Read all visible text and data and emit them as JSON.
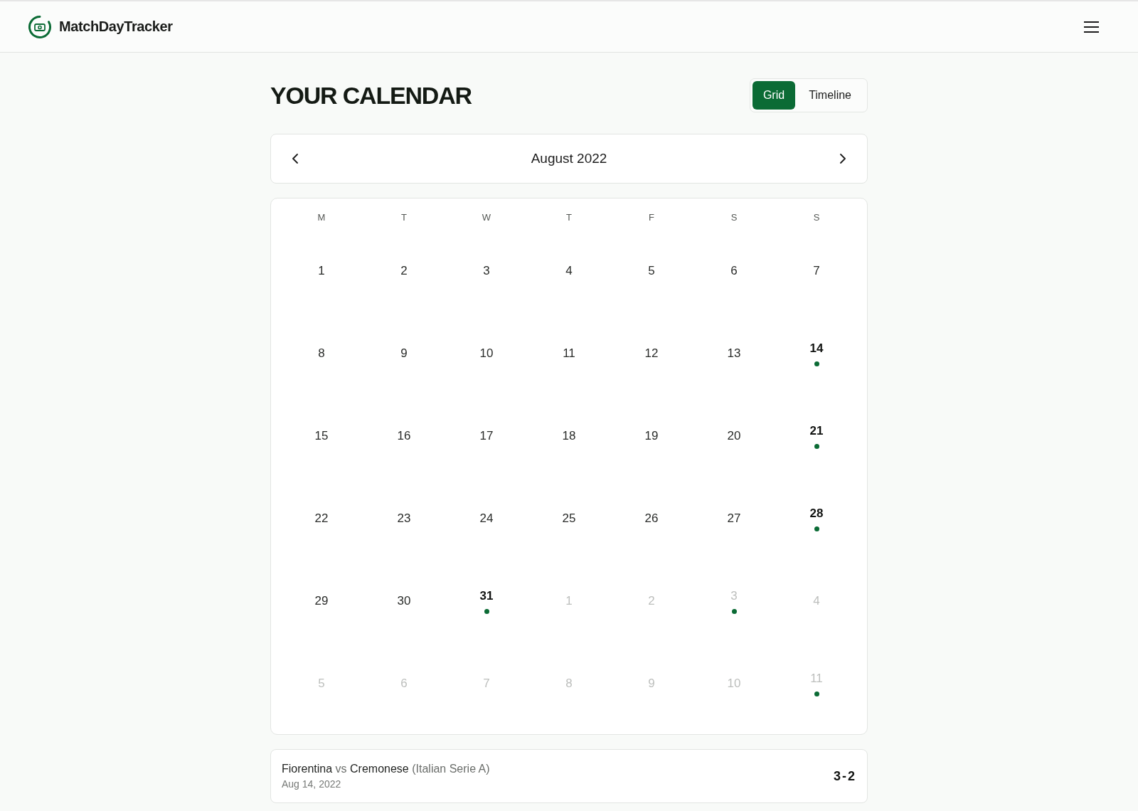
{
  "header": {
    "brand": "MatchDayTracker"
  },
  "title": "YOUR CALENDAR",
  "view_toggle": [
    {
      "label": "Grid",
      "selected": true
    },
    {
      "label": "Timeline",
      "selected": false
    }
  ],
  "month_nav": {
    "month": "August 2022"
  },
  "calendar": {
    "weekdays": [
      "M",
      "T",
      "W",
      "T",
      "F",
      "S",
      "S"
    ],
    "days": [
      {
        "label": "1",
        "in_month": true,
        "match": false
      },
      {
        "label": "2",
        "in_month": true,
        "match": false
      },
      {
        "label": "3",
        "in_month": true,
        "match": false
      },
      {
        "label": "4",
        "in_month": true,
        "match": false
      },
      {
        "label": "5",
        "in_month": true,
        "match": false
      },
      {
        "label": "6",
        "in_month": true,
        "match": false
      },
      {
        "label": "7",
        "in_month": true,
        "match": false
      },
      {
        "label": "8",
        "in_month": true,
        "match": false
      },
      {
        "label": "9",
        "in_month": true,
        "match": false
      },
      {
        "label": "10",
        "in_month": true,
        "match": false
      },
      {
        "label": "11",
        "in_month": true,
        "match": false
      },
      {
        "label": "12",
        "in_month": true,
        "match": false
      },
      {
        "label": "13",
        "in_month": true,
        "match": false
      },
      {
        "label": "14",
        "in_month": true,
        "match": true
      },
      {
        "label": "15",
        "in_month": true,
        "match": false
      },
      {
        "label": "16",
        "in_month": true,
        "match": false
      },
      {
        "label": "17",
        "in_month": true,
        "match": false
      },
      {
        "label": "18",
        "in_month": true,
        "match": false
      },
      {
        "label": "19",
        "in_month": true,
        "match": false
      },
      {
        "label": "20",
        "in_month": true,
        "match": false
      },
      {
        "label": "21",
        "in_month": true,
        "match": true
      },
      {
        "label": "22",
        "in_month": true,
        "match": false
      },
      {
        "label": "23",
        "in_month": true,
        "match": false
      },
      {
        "label": "24",
        "in_month": true,
        "match": false
      },
      {
        "label": "25",
        "in_month": true,
        "match": false
      },
      {
        "label": "26",
        "in_month": true,
        "match": false
      },
      {
        "label": "27",
        "in_month": true,
        "match": false
      },
      {
        "label": "28",
        "in_month": true,
        "match": true
      },
      {
        "label": "29",
        "in_month": true,
        "match": false
      },
      {
        "label": "30",
        "in_month": true,
        "match": false
      },
      {
        "label": "31",
        "in_month": true,
        "match": true
      },
      {
        "label": "1",
        "in_month": false,
        "match": false
      },
      {
        "label": "2",
        "in_month": false,
        "match": false
      },
      {
        "label": "3",
        "in_month": false,
        "match": true
      },
      {
        "label": "4",
        "in_month": false,
        "match": false
      },
      {
        "label": "5",
        "in_month": false,
        "match": false
      },
      {
        "label": "6",
        "in_month": false,
        "match": false
      },
      {
        "label": "7",
        "in_month": false,
        "match": false
      },
      {
        "label": "8",
        "in_month": false,
        "match": false
      },
      {
        "label": "9",
        "in_month": false,
        "match": false
      },
      {
        "label": "10",
        "in_month": false,
        "match": false
      },
      {
        "label": "11",
        "in_month": false,
        "match": true
      }
    ]
  },
  "matches": [
    {
      "home_team": "Fiorentina",
      "separator": "vs",
      "away_team": "Cremonese",
      "league": "(Italian Serie A)",
      "date": "Aug 14, 2022",
      "score": "3-2"
    }
  ]
}
